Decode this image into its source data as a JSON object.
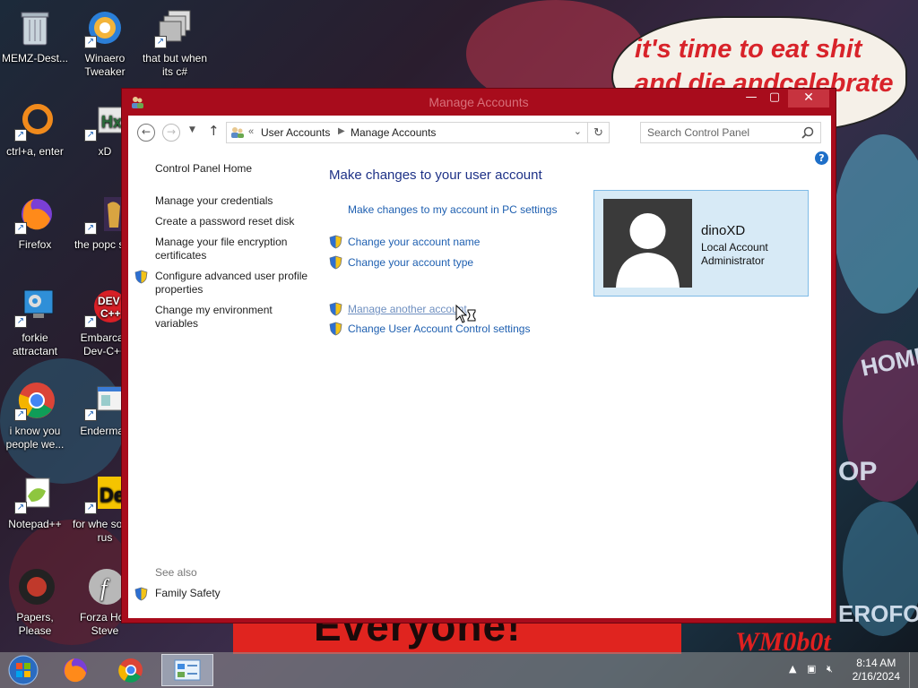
{
  "desktop": {
    "icons": [
      {
        "label": "MEMZ-Dest...",
        "icon": "recycle-bin-icon"
      },
      {
        "label": "Winaero Tweaker",
        "icon": "winaero-icon"
      },
      {
        "label": "that but when its c#",
        "icon": "stacked-windows-icon"
      },
      {
        "label": "ctrl+a, enter",
        "icon": "ring-icon"
      },
      {
        "label": "xD",
        "icon": "hex-icon"
      },
      {
        "label": "Firefox",
        "icon": "firefox-icon"
      },
      {
        "label": "the popc shit",
        "icon": "popcorn-icon"
      },
      {
        "label": "forkie attractant",
        "icon": "monitor-gear-icon"
      },
      {
        "label": "Embarcad Dev-C++",
        "icon": "devcpp-icon"
      },
      {
        "label": "i know you people we...",
        "icon": "chrome-icon"
      },
      {
        "label": "Enderman",
        "icon": "window-app-icon"
      },
      {
        "label": "Notepad++",
        "icon": "notepadpp-icon"
      },
      {
        "label": "for whe some rus",
        "icon": "de-icon"
      },
      {
        "label": "Papers, Please",
        "icon": "papers-please-icon"
      },
      {
        "label": "Forza Hori Steve",
        "icon": "flash-icon"
      }
    ],
    "speech_bubble": "it's time to eat shit and die andcelebrate",
    "banner_text": "Everyone!",
    "watermark": "WM0b0t",
    "side_text_1": "HOME",
    "side_text_2": "OP",
    "side_text_3": "EROFOS"
  },
  "window": {
    "title": "Manage Accounts",
    "address": {
      "crumbs": [
        "User Accounts",
        "Manage Accounts"
      ],
      "chevron": "«"
    },
    "search_placeholder": "Search Control Panel",
    "help": "?",
    "left_pane": {
      "home": "Control Panel Home",
      "links": [
        "Manage your credentials",
        "Create a password reset disk",
        "Manage your file encryption certificates",
        "Configure advanced user profile properties",
        "Change my environment variables"
      ],
      "see_also_label": "See also",
      "family_safety": "Family Safety"
    },
    "main": {
      "heading": "Make changes to your user account",
      "pc_settings_link": "Make changes to my account in PC settings",
      "change_name": "Change your account name",
      "change_type": "Change your account type",
      "manage_another": "Manage another account",
      "uac_settings": "Change User Account Control settings"
    },
    "user": {
      "name": "dinoXD",
      "type": "Local Account",
      "role": "Administrator"
    }
  },
  "taskbar": {
    "time": "8:14 AM",
    "date": "2/16/2024"
  },
  "colors": {
    "window_frame": "#a80c1c",
    "close_button": "#c7333f",
    "link": "#1e5fb0",
    "heading": "#1e3287",
    "user_card_bg": "#d7eaf6"
  }
}
